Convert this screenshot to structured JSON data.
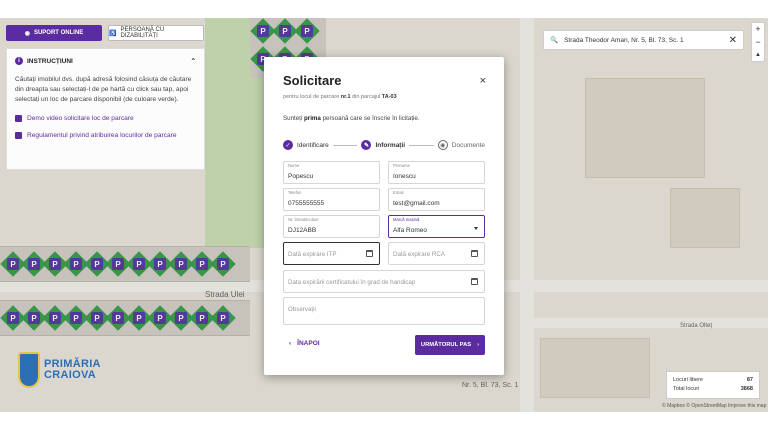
{
  "topbar": {
    "support_label": "SUPORT ONLINE",
    "disability_label": "PERSOANĂ CU DIZABILITĂȚI"
  },
  "instructions": {
    "title": "INSTRUCȚIUNI",
    "text": "Căutați imobilul dvs. după adresă folosind căsuța de căutare din dreapta sau selectați-l de pe hartă cu click sau tap, apoi selectați un loc de parcare disponibil (de culoare verde).",
    "link_video": "Demo video solicitare loc de parcare",
    "link_rules": "Regulamentul privind atribuirea locurilor de parcare"
  },
  "search": {
    "value": "Strada Theodor Aman, Nr. 5, Bl. 73, Sc. 1"
  },
  "zoom": {
    "plus": "+",
    "minus": "−",
    "compass": "▲"
  },
  "map_labels": {
    "street_1": "Strada Ulei",
    "street_2": "Strada Olteț",
    "address": "Nr. 5, Bl. 73, Sc. 1"
  },
  "parking_tile_label": "P",
  "legend": {
    "free_label": "Locuri libere",
    "free_value": "87",
    "total_label": "Total locuri",
    "total_value": "3868"
  },
  "attribution": "© Mapbox © OpenStreetMap Improve this map",
  "logo": {
    "line1": "PRIMĂRIA",
    "line2": "CRAIOVA"
  },
  "modal": {
    "title": "Solicitare",
    "subtitle_prefix": "pentru locul de parcare",
    "spot_number": "nr.1",
    "subtitle_mid": "din parcajul",
    "lot_code": "TA-03",
    "note_prefix": "Sunteți",
    "note_bold": "prima",
    "note_suffix": "persoană care se înscrie în licitație.",
    "close": "×",
    "steps": [
      {
        "label": "Identificare",
        "icon": "✓"
      },
      {
        "label": "Informații",
        "icon": "✎"
      },
      {
        "label": "Documente",
        "icon": "◉"
      }
    ],
    "fields": {
      "nume": {
        "label": "Nume",
        "value": "Popescu"
      },
      "prenume": {
        "label": "Prenume",
        "value": "Ionescu"
      },
      "telefon": {
        "label": "Telefon",
        "value": "0755555555"
      },
      "email": {
        "label": "Email",
        "value": "test@gmail.com"
      },
      "inmatriculare": {
        "label": "Nr. înmatriculare",
        "value": "DJ12ABB"
      },
      "marca": {
        "label": "Marcă mașină",
        "value": "Alfa Romeo"
      },
      "itp": {
        "placeholder": "Dată expirare ITP"
      },
      "rca": {
        "placeholder": "Dată expirare RCA"
      },
      "handicap": {
        "placeholder": "Data expirării certificatului în grad de handicap"
      },
      "observatii": {
        "placeholder": "Observații"
      }
    },
    "back_label": "ÎNAPOI",
    "next_label": "URMĂTORUL PAS"
  }
}
